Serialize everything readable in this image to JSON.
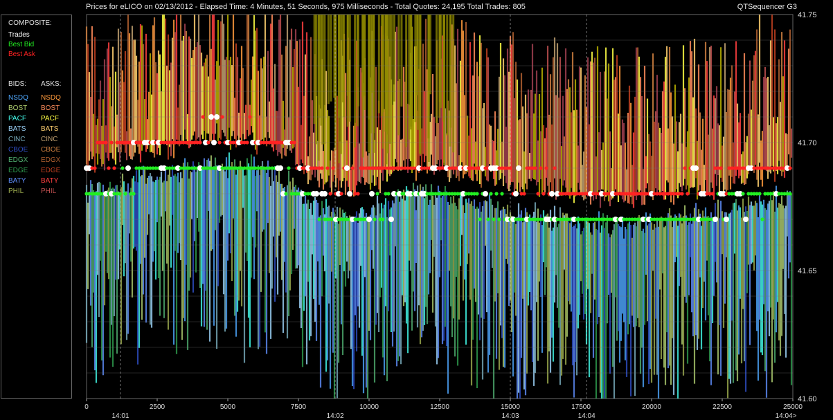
{
  "header": {
    "title": "Prices for  eLICO  on  02/13/2012  -  Elapsed Time: 4 Minutes, 51 Seconds, 975 Milliseconds  -  Total Quotes: 24,195  Total Trades: 805",
    "app_name": "QTSequencer G3"
  },
  "legend": {
    "composite_label": "COMPOSITE:",
    "composite_items": [
      {
        "label": "Trades",
        "color": "#ffffff"
      },
      {
        "label": "Best Bid",
        "color": "#22ee22"
      },
      {
        "label": "Best Ask",
        "color": "#ff2222"
      }
    ],
    "bids_label": "BIDS:",
    "asks_label": "ASKS:",
    "exchanges": [
      {
        "bid": "NSDQ",
        "bid_color": "#4fa8ff",
        "ask": "NSDQ",
        "ask_color": "#ff9a3c"
      },
      {
        "bid": "BOST",
        "bid_color": "#b0d070",
        "ask": "BOST",
        "ask_color": "#ff8c5a"
      },
      {
        "bid": "PACF",
        "bid_color": "#44ffee",
        "ask": "PACF",
        "ask_color": "#ffff44"
      },
      {
        "bid": "BATS",
        "bid_color": "#a0d8ff",
        "ask": "BATS",
        "ask_color": "#ffd070"
      },
      {
        "bid": "CINC",
        "bid_color": "#7ab0c0",
        "ask": "CINC",
        "ask_color": "#c0a070"
      },
      {
        "bid": "CBOE",
        "bid_color": "#3050c8",
        "ask": "CBOE",
        "ask_color": "#d08040"
      },
      {
        "bid": "EDGX",
        "bid_color": "#50b070",
        "ask": "EDGX",
        "ask_color": "#b06030"
      },
      {
        "bid": "EDGE",
        "bid_color": "#30a050",
        "ask": "EDGE",
        "ask_color": "#c04020"
      },
      {
        "bid": "BATY",
        "bid_color": "#6090ff",
        "ask": "BATY",
        "ask_color": "#ff4040"
      },
      {
        "bid": "PHIL",
        "bid_color": "#a0b050",
        "ask": "PHIL",
        "ask_color": "#c05050"
      }
    ]
  },
  "chart_data": {
    "type": "line",
    "x_range": [
      0,
      25000
    ],
    "y_range": [
      41.6,
      41.75
    ],
    "x_ticks": [
      0,
      2500,
      5000,
      7500,
      10000,
      12500,
      15000,
      17500,
      20000,
      22500,
      25000
    ],
    "y_ticks": [
      "41.60",
      "41.65",
      "41.70",
      "41.75"
    ],
    "time_labels": [
      {
        "x": 1200,
        "label": "14:01"
      },
      {
        "x": 8800,
        "label": "14:02"
      },
      {
        "x": 15000,
        "label": "14:03"
      },
      {
        "x": 17700,
        "label": "14:04"
      },
      {
        "x": 25000,
        "label": "14:04>"
      }
    ],
    "price_levels": [
      41.6,
      41.61,
      41.62,
      41.63,
      41.64,
      41.65,
      41.66,
      41.67,
      41.68,
      41.69,
      41.7,
      41.71,
      41.72,
      41.73,
      41.74,
      41.75
    ],
    "grid": true,
    "legend": "left"
  }
}
